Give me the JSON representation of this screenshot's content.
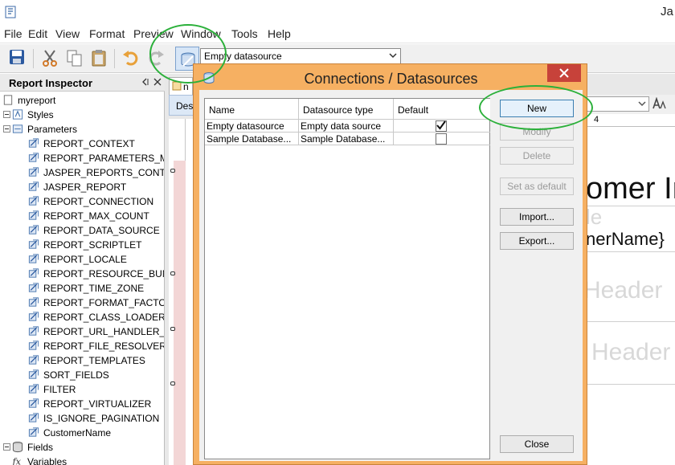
{
  "app": {
    "title": "Ja"
  },
  "menu": [
    "File",
    "Edit",
    "View",
    "Format",
    "Preview",
    "Window",
    "Tools",
    "Help"
  ],
  "toolbar": {
    "datasource_selected": "Empty datasource"
  },
  "inspector": {
    "title": "Report Inspector",
    "tree": [
      {
        "label": "myreport",
        "icon": "report-icon"
      },
      {
        "label": "Styles",
        "icon": "styles-icon"
      },
      {
        "label": "Parameters",
        "icon": "parameters-icon"
      },
      {
        "label": "REPORT_CONTEXT",
        "icon": "parameter-icon"
      },
      {
        "label": "REPORT_PARAMETERS_M",
        "icon": "parameter-icon"
      },
      {
        "label": "JASPER_REPORTS_CONT",
        "icon": "parameter-icon"
      },
      {
        "label": "JASPER_REPORT",
        "icon": "parameter-icon"
      },
      {
        "label": "REPORT_CONNECTION",
        "icon": "parameter-icon"
      },
      {
        "label": "REPORT_MAX_COUNT",
        "icon": "parameter-icon"
      },
      {
        "label": "REPORT_DATA_SOURCE",
        "icon": "parameter-icon"
      },
      {
        "label": "REPORT_SCRIPTLET",
        "icon": "parameter-icon"
      },
      {
        "label": "REPORT_LOCALE",
        "icon": "parameter-icon"
      },
      {
        "label": "REPORT_RESOURCE_BUN",
        "icon": "parameter-icon"
      },
      {
        "label": "REPORT_TIME_ZONE",
        "icon": "parameter-icon"
      },
      {
        "label": "REPORT_FORMAT_FACTO",
        "icon": "parameter-icon"
      },
      {
        "label": "REPORT_CLASS_LOADER",
        "icon": "parameter-icon"
      },
      {
        "label": "REPORT_URL_HANDLER_F",
        "icon": "parameter-icon"
      },
      {
        "label": "REPORT_FILE_RESOLVER",
        "icon": "parameter-icon"
      },
      {
        "label": "REPORT_TEMPLATES",
        "icon": "parameter-icon"
      },
      {
        "label": "SORT_FIELDS",
        "icon": "parameter-icon"
      },
      {
        "label": "FILTER",
        "icon": "parameter-icon"
      },
      {
        "label": "REPORT_VIRTUALIZER",
        "icon": "parameter-icon"
      },
      {
        "label": "IS_IGNORE_PAGINATION",
        "icon": "parameter-icon"
      },
      {
        "label": "CustomerName",
        "icon": "parameter-icon"
      },
      {
        "label": "Fields",
        "icon": "fields-icon"
      },
      {
        "label": "Variables",
        "icon": "variables-icon"
      }
    ]
  },
  "designer": {
    "tab_label": "n",
    "design_tab": "Des",
    "ruler_number": "4",
    "title_text": "omer In",
    "ghost_title": "le",
    "field_text": "nerName}",
    "ghost_header_1": "Header",
    "ghost_header_2": "Header"
  },
  "dialog": {
    "title": "Connections / Datasources",
    "columns": [
      "Name",
      "Datasource type",
      "Default"
    ],
    "rows": [
      {
        "name": "Empty datasource",
        "type": "Empty data source",
        "default": true
      },
      {
        "name": "Sample Database...",
        "type": "Sample Database...",
        "default": false
      }
    ],
    "buttons": {
      "new": "New",
      "modify": "Modify",
      "delete": "Delete",
      "set_default": "Set as default",
      "import": "Import...",
      "export": "Export...",
      "close": "Close"
    }
  },
  "colors": {
    "dialog_frame": "#f6b062",
    "close_button": "#c7423a",
    "annotation": "#2bb03a"
  }
}
